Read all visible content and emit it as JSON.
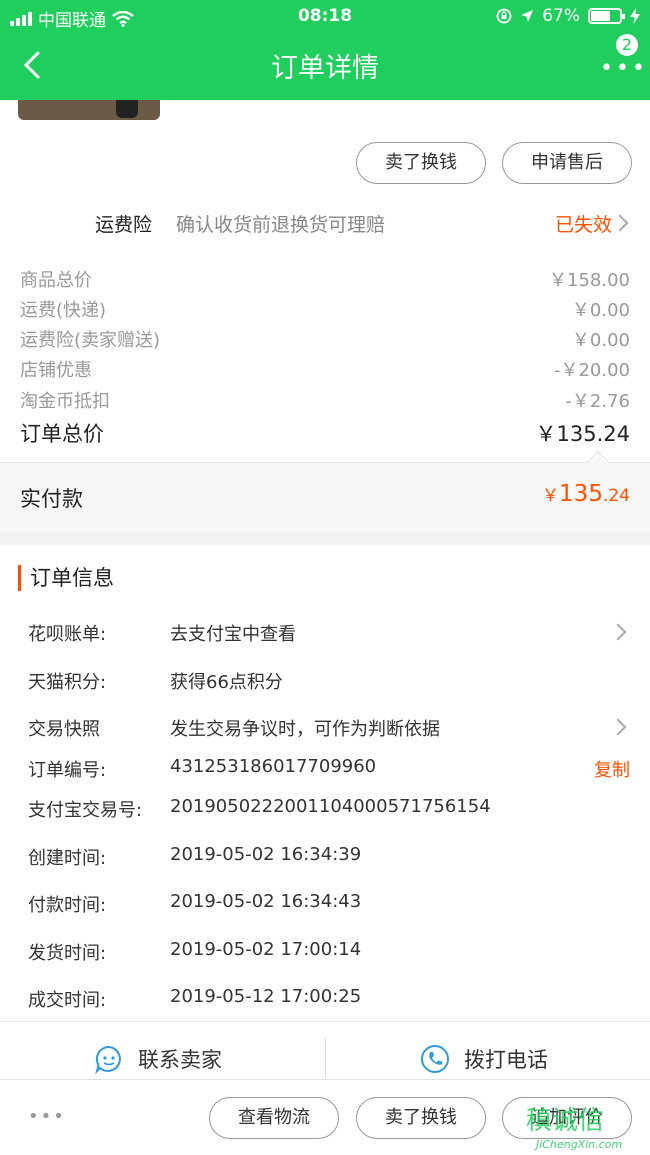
{
  "status_bar": {
    "carrier": "中国联通",
    "time": "08:18",
    "battery": "67%",
    "battery_level": 0.67
  },
  "nav": {
    "title": "订单详情",
    "badge": "2"
  },
  "actions_top": {
    "sell": "卖了换钱",
    "after_sale": "申请售后"
  },
  "insurance": {
    "label": "运费险",
    "desc": "确认收货前退换货可理赔",
    "status": "已失效"
  },
  "prices": [
    {
      "label": "商品总价",
      "value": "￥158.00"
    },
    {
      "label": "运费(快递)",
      "value": "￥0.00"
    },
    {
      "label": "运费险(卖家赠送)",
      "value": "￥0.00"
    },
    {
      "label": "店铺优惠",
      "value": "-￥20.00"
    },
    {
      "label": "淘金币抵扣",
      "value": "-￥2.76"
    }
  ],
  "order_total": {
    "label": "订单总价",
    "value": "￥135.24"
  },
  "paid": {
    "label": "实付款",
    "symbol": "￥",
    "int": "135",
    "dec": ".24"
  },
  "order_info": {
    "title": "订单信息",
    "rows": [
      {
        "k": "花呗账单:",
        "v": "去支付宝中查看"
      },
      {
        "k": "天猫积分:",
        "v": "获得66点积分"
      },
      {
        "k": "交易快照",
        "v": "发生交易争议时，可作为判断依据"
      },
      {
        "k": "订单编号:",
        "v": "431253186017709960",
        "action": "复制"
      },
      {
        "k": "支付宝交易号:",
        "v": "2019050222001104000571756154"
      },
      {
        "k": "创建时间:",
        "v": "2019-05-02 16:34:39"
      },
      {
        "k": "付款时间:",
        "v": "2019-05-02 16:34:43"
      },
      {
        "k": "发货时间:",
        "v": "2019-05-02 17:00:14"
      },
      {
        "k": "成交时间:",
        "v": "2019-05-12 17:00:25"
      }
    ]
  },
  "contact": {
    "seller": "联系卖家",
    "phone": "拨打电话"
  },
  "toolbar": {
    "more": "•••",
    "logistics": "查看物流",
    "sell": "卖了换钱",
    "review": "追加评价"
  },
  "watermark": {
    "main": "稹诚信",
    "sub": "JiChengXin.com"
  },
  "colors": {
    "brand": "#1fce5c",
    "accent": "#ff5000"
  }
}
